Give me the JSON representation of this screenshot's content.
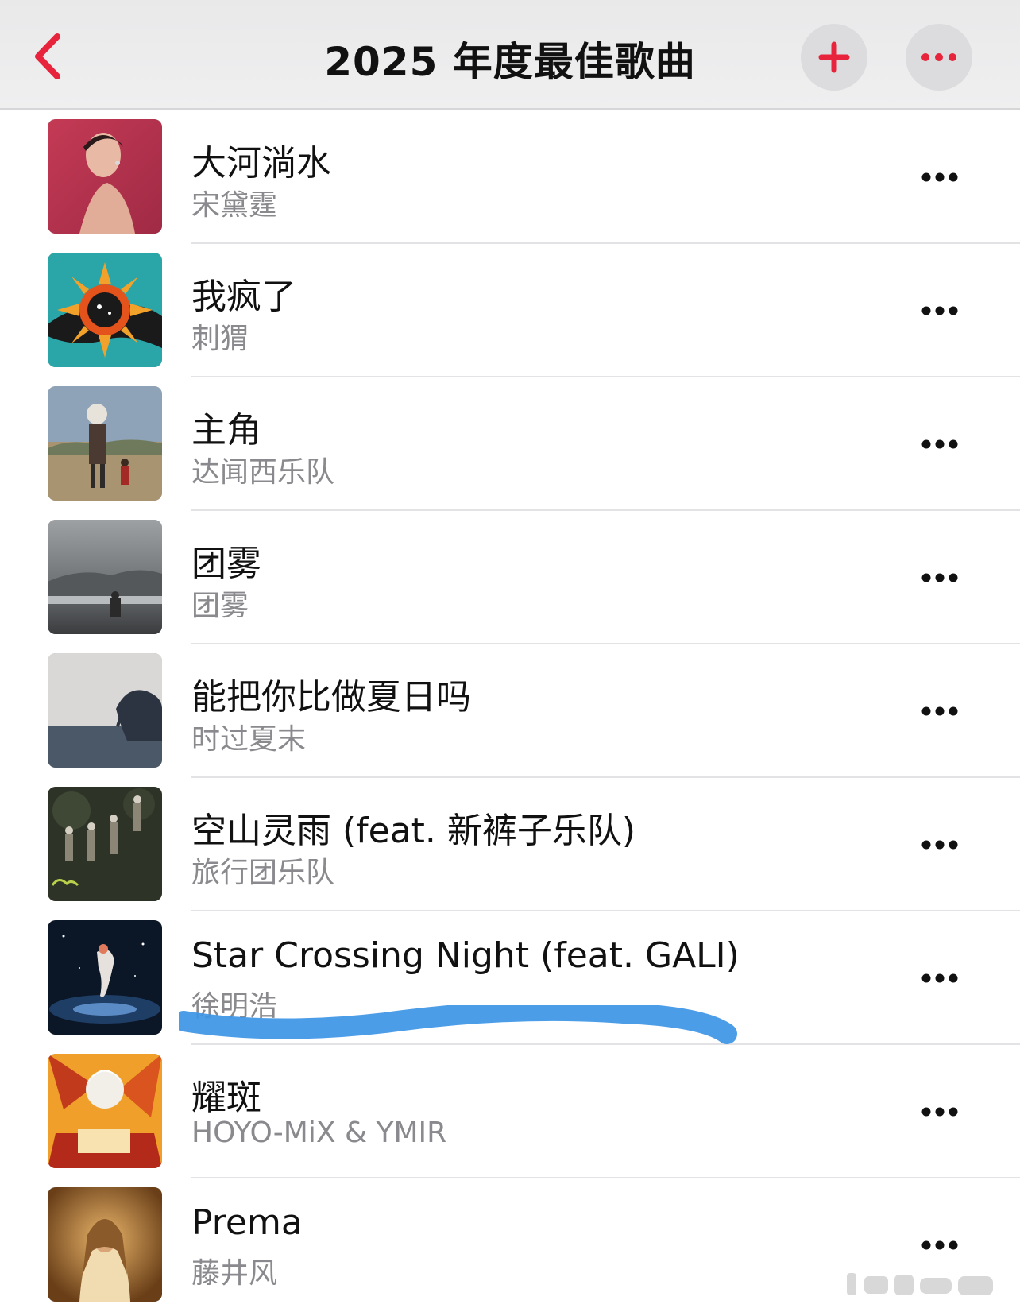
{
  "nav": {
    "title": "2025 年度最佳歌曲",
    "back_icon": "chevron-left-icon",
    "add_icon": "plus-icon",
    "more_icon": "ellipsis-icon",
    "accent_color": "#e8243c"
  },
  "songs": [
    {
      "title": "大河淌水",
      "artist": "宋黛霆"
    },
    {
      "title": "我疯了",
      "artist": "刺猬"
    },
    {
      "title": "主角",
      "artist": "达闻西乐队"
    },
    {
      "title": "团雾",
      "artist": "团雾"
    },
    {
      "title": "能把你比做夏日吗",
      "artist": "时过夏末"
    },
    {
      "title": "空山灵雨 (feat. 新裤子乐队)",
      "artist": "旅行团乐队"
    },
    {
      "title": "Star Crossing Night (feat. GALI)",
      "artist": "徐明浩"
    },
    {
      "title": "耀斑",
      "artist": "HOYO-MiX & YMIR"
    },
    {
      "title": "Prema",
      "artist": "藤井风"
    }
  ],
  "annotation": {
    "highlight_color": "#3d95e6",
    "marked_song": "Star Crossing Night (feat. GALI)"
  }
}
